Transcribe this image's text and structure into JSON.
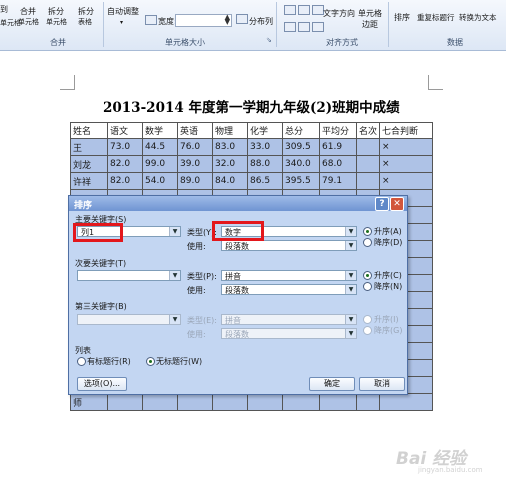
{
  "ribbon": {
    "merge_buttons": [
      "合并",
      "拆分",
      "拆分"
    ],
    "merge_buttons_line2": [
      "单元格",
      "单元格",
      "表格"
    ],
    "left_cut": "到",
    "left_cut2": "单元格",
    "auto_adjust": "自动调整",
    "width_label": "宽度:",
    "distribute_cols": "分布列",
    "text_direction": "文字方向",
    "cell_margins": "单元格",
    "cell_margins_2": "边距",
    "sort": "排序",
    "repeat_header": "重复标题行",
    "convert_text": "转换为文本",
    "groups": {
      "merge": "合并",
      "cell_size": "单元格大小",
      "alignment": "对齐方式",
      "data": "数据"
    }
  },
  "document": {
    "title": "2013-2014 年度第一学期九年级(2)班期中成绩",
    "table": {
      "headers": [
        "姓名",
        "语文",
        "数学",
        "英语",
        "物理",
        "化学",
        "总分",
        "平均分",
        "名次",
        "七合判断"
      ],
      "rows": [
        [
          "王",
          "73.0",
          "44.5",
          "76.0",
          "83.0",
          "33.0",
          "309.5",
          "61.9",
          "",
          "×"
        ],
        [
          "刘龙",
          "82.0",
          "99.0",
          "39.0",
          "32.0",
          "88.0",
          "340.0",
          "68.0",
          "",
          "×"
        ],
        [
          "许祥",
          "82.0",
          "54.0",
          "89.0",
          "84.0",
          "86.5",
          "395.5",
          "79.1",
          "",
          "×"
        ]
      ],
      "last_row_first_cell": "师"
    }
  },
  "dialog": {
    "title": "排序",
    "help_glyph": "?",
    "close_glyph": "✕",
    "primary": {
      "label": "主要关键字(S)",
      "key": "列1",
      "type_label": "类型(Y):",
      "type_value": "数字",
      "use_label": "使用:",
      "use_value": "段落数",
      "asc": "升序(A)",
      "desc": "降序(D)"
    },
    "secondary": {
      "label": "次要关键字(T)",
      "key": "",
      "type_label": "类型(P):",
      "type_value": "拼音",
      "use_label": "使用:",
      "use_value": "段落数",
      "asc": "升序(C)",
      "desc": "降序(N)"
    },
    "tertiary": {
      "label": "第三关键字(B)",
      "key": "",
      "type_label": "类型(E):",
      "type_value": "拼音",
      "use_label": "使用:",
      "use_value": "段落数",
      "asc": "升序(I)",
      "desc": "降序(G)"
    },
    "list": {
      "label": "列表",
      "has_header": "有标题行(R)",
      "no_header": "无标题行(W)"
    },
    "options_btn": "选项(O)...",
    "ok_btn": "确定",
    "cancel_btn": "取消"
  },
  "watermark": {
    "text": "Bai 经验",
    "sub": "jingyan.baidu.com"
  },
  "colors": {
    "highlight": "#aec2e6",
    "dialog_bg": "#c3d6f2",
    "red_box": "#e3171c",
    "title_bar": "#6f94d2"
  }
}
